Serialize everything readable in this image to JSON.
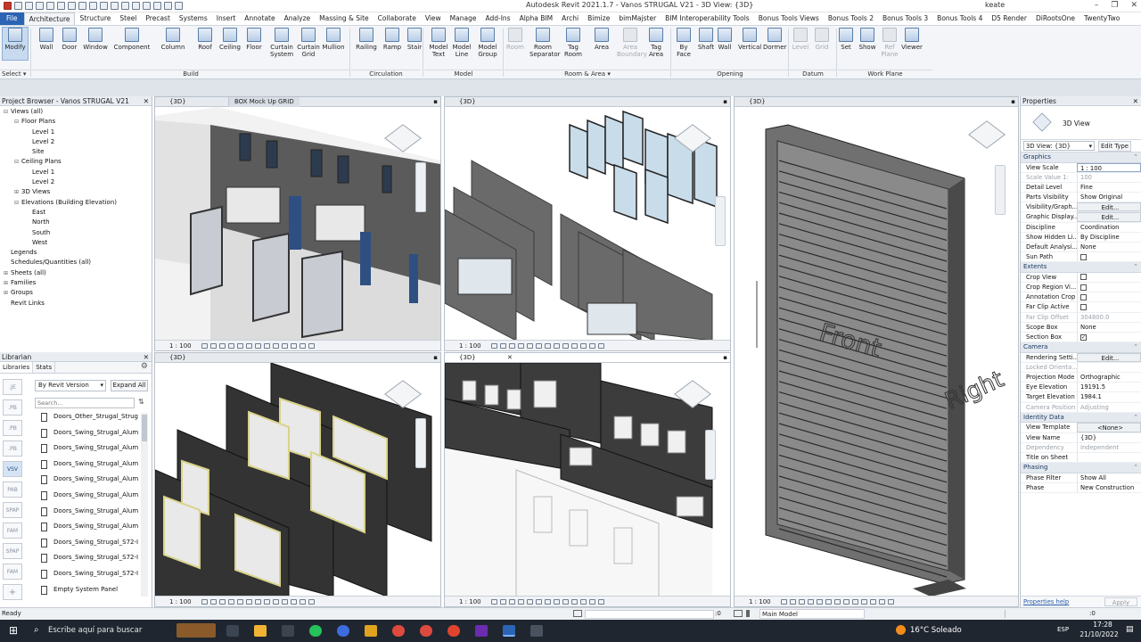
{
  "window": {
    "title": "Autodesk Revit 2021.1.7 - Vanos STRUGAL V21 - 3D View: {3D}",
    "user": "keate"
  },
  "tabs": [
    "File",
    "Architecture",
    "Structure",
    "Steel",
    "Precast",
    "Systems",
    "Insert",
    "Annotate",
    "Analyze",
    "Massing & Site",
    "Collaborate",
    "View",
    "Manage",
    "Add-Ins",
    "Alpha BIM",
    "Archi",
    "Bimize",
    "bimMajster",
    "BIM Interoperability Tools",
    "Bonus Tools Views",
    "Bonus Tools 2",
    "Bonus Tools 3",
    "Bonus Tools 4",
    "D5 Render",
    "DiRootsOne",
    "TwentyTwo"
  ],
  "active_tab": "Architecture",
  "ribbon": {
    "buttons": [
      {
        "label": "Modify",
        "active": true
      },
      {
        "label": "Wall"
      },
      {
        "label": "Door"
      },
      {
        "label": "Window"
      },
      {
        "label": "Component"
      },
      {
        "label": "Column"
      },
      {
        "label": "Roof"
      },
      {
        "label": "Ceiling"
      },
      {
        "label": "Floor"
      },
      {
        "label": "Curtain System"
      },
      {
        "label": "Curtain Grid"
      },
      {
        "label": "Mullion"
      },
      {
        "label": "Railing"
      },
      {
        "label": "Ramp"
      },
      {
        "label": "Stair"
      },
      {
        "label": "Model Text"
      },
      {
        "label": "Model Line"
      },
      {
        "label": "Model Group"
      },
      {
        "label": "Room",
        "dim": true
      },
      {
        "label": "Room Separator"
      },
      {
        "label": "Tag Room"
      },
      {
        "label": "Area"
      },
      {
        "label": "Area Boundary",
        "dim": true
      },
      {
        "label": "Tag Area"
      },
      {
        "label": "By Face"
      },
      {
        "label": "Shaft"
      },
      {
        "label": "Wall"
      },
      {
        "label": "Vertical"
      },
      {
        "label": "Dormer"
      },
      {
        "label": "Level",
        "dim": true
      },
      {
        "label": "Grid",
        "dim": true
      },
      {
        "label": "Set"
      },
      {
        "label": "Show"
      },
      {
        "label": "Ref Plane",
        "dim": true
      },
      {
        "label": "Viewer"
      }
    ],
    "groups": [
      "Select ▾",
      "Build",
      "Circulation",
      "Model",
      "Room & Area ▾",
      "Opening",
      "Datum",
      "Work Plane"
    ]
  },
  "project_browser": {
    "title": "Project Browser - Vanos STRUGAL V21",
    "items": [
      {
        "label": "Views (all)",
        "toggle": "⊟",
        "indent": 0
      },
      {
        "label": "Floor Plans",
        "toggle": "⊟",
        "indent": 1
      },
      {
        "label": "Level 1",
        "toggle": "",
        "indent": 2
      },
      {
        "label": "Level 2",
        "toggle": "",
        "indent": 2
      },
      {
        "label": "Site",
        "toggle": "",
        "indent": 2
      },
      {
        "label": "Ceiling Plans",
        "toggle": "⊟",
        "indent": 1
      },
      {
        "label": "Level 1",
        "toggle": "",
        "indent": 2
      },
      {
        "label": "Level 2",
        "toggle": "",
        "indent": 2
      },
      {
        "label": "3D Views",
        "toggle": "⊞",
        "indent": 1
      },
      {
        "label": "Elevations (Building Elevation)",
        "toggle": "⊟",
        "indent": 1
      },
      {
        "label": "East",
        "toggle": "",
        "indent": 2
      },
      {
        "label": "North",
        "toggle": "",
        "indent": 2
      },
      {
        "label": "South",
        "toggle": "",
        "indent": 2
      },
      {
        "label": "West",
        "toggle": "",
        "indent": 2
      },
      {
        "label": "Legends",
        "toggle": "",
        "indent": 0
      },
      {
        "label": "Schedules/Quantities (all)",
        "toggle": "",
        "indent": 0
      },
      {
        "label": "Sheets (all)",
        "toggle": "⊞",
        "indent": 0
      },
      {
        "label": "Families",
        "toggle": "⊞",
        "indent": 0
      },
      {
        "label": "Groups",
        "toggle": "⊞",
        "indent": 0
      },
      {
        "label": "Revit Links",
        "toggle": "",
        "indent": 0
      }
    ]
  },
  "librarian": {
    "title": "Librarian",
    "tabs": [
      "Libraries",
      "Stats"
    ],
    "sort": "By Revit Version",
    "expand_label": "Expand All",
    "search_placeholder": "Search...",
    "side": [
      ".JE",
      ".PB",
      ".PB",
      ".PB",
      "VSV",
      "PAB",
      "SPAP",
      "FAM",
      "SPAP",
      "FAM"
    ],
    "items": [
      "Doors_Other_Strugal_Strug",
      "Doors_Swing_Strugal_Alum",
      "Doors_Swing_Strugal_Alum",
      "Doors_Swing_Strugal_Alum",
      "Doors_Swing_Strugal_Alum",
      "Doors_Swing_Strugal_Alum",
      "Doors_Swing_Strugal_Alum",
      "Doors_Swing_Strugal_Alum",
      "Doors_Swing_Strugal_S72-I",
      "Doors_Swing_Strugal_S72-I",
      "Doors_Swing_Strugal_S72-I",
      "Empty System Panel"
    ]
  },
  "views": {
    "tl": {
      "title": "{3D}",
      "tab2": "BOX Mock Up GRID",
      "scale": "1 : 100"
    },
    "tr": {
      "title": "{3D}",
      "scale": "1 : 100"
    },
    "bl": {
      "title": "{3D}",
      "scale": "1 : 100"
    },
    "bm": {
      "title": "{3D}",
      "scale": "1 : 100"
    },
    "right": {
      "title": "{3D}",
      "scale": "1 : 100",
      "label_front": "Front",
      "label_right": "Right"
    }
  },
  "properties": {
    "title": "Properties",
    "type_name": "3D View",
    "selector": "3D View: {3D}",
    "edit_type": "Edit Type",
    "sections": [
      {
        "name": "Graphics",
        "rows": [
          {
            "k": "View Scale",
            "v": "1 : 100",
            "input": true
          },
          {
            "k": "Scale Value    1:",
            "v": "100",
            "dim": true
          },
          {
            "k": "Detail Level",
            "v": "Fine"
          },
          {
            "k": "Parts Visibility",
            "v": "Show Original"
          },
          {
            "k": "Visibility/Graph...",
            "v": "Edit...",
            "btn": true
          },
          {
            "k": "Graphic Display...",
            "v": "Edit...",
            "btn": true
          },
          {
            "k": "Discipline",
            "v": "Coordination"
          },
          {
            "k": "Show Hidden Li...",
            "v": "By Discipline"
          },
          {
            "k": "Default Analysi...",
            "v": "None"
          },
          {
            "k": "Sun Path",
            "check": false
          }
        ]
      },
      {
        "name": "Extents",
        "rows": [
          {
            "k": "Crop View",
            "check": false
          },
          {
            "k": "Crop Region Vi...",
            "check": false
          },
          {
            "k": "Annotation Crop",
            "check": false
          },
          {
            "k": "Far Clip Active",
            "check": false
          },
          {
            "k": "Far Clip Offset",
            "v": "304800.0",
            "dim": true
          },
          {
            "k": "Scope Box",
            "v": "None"
          },
          {
            "k": "Section Box",
            "check": true
          }
        ]
      },
      {
        "name": "Camera",
        "rows": [
          {
            "k": "Rendering Setti...",
            "v": "Edit...",
            "btn": true
          },
          {
            "k": "Locked Orienta...",
            "v": "",
            "dim": true
          },
          {
            "k": "Projection Mode",
            "v": "Orthographic"
          },
          {
            "k": "Eye Elevation",
            "v": "19191.5"
          },
          {
            "k": "Target Elevation",
            "v": "1984.1"
          },
          {
            "k": "Camera Position",
            "v": "Adjusting",
            "dim": true
          }
        ]
      },
      {
        "name": "Identity Data",
        "rows": [
          {
            "k": "View Template",
            "v": "<None>",
            "btn": true
          },
          {
            "k": "View Name",
            "v": "{3D}"
          },
          {
            "k": "Dependency",
            "v": "Independent",
            "dim": true
          },
          {
            "k": "Title on Sheet",
            "v": ""
          }
        ]
      },
      {
        "name": "Phasing",
        "rows": [
          {
            "k": "Phase Filter",
            "v": "Show All"
          },
          {
            "k": "Phase",
            "v": "New Construction"
          }
        ]
      }
    ],
    "help": "Properties help",
    "apply": "Apply"
  },
  "status": {
    "text": "Ready",
    "zero": ":0",
    "model": "Main Model",
    "filter": ":0"
  },
  "taskbar": {
    "search": "Escribe aquí para buscar",
    "weather": "16°C  Soleado",
    "lang": "ESP",
    "time": "17:28",
    "date": "21/10/2022"
  }
}
